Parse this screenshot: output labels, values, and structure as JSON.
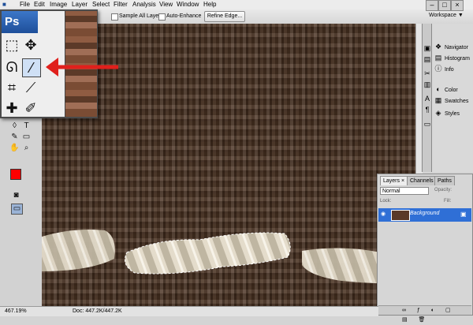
{
  "menu": {
    "items": [
      {
        "id": "file",
        "label": "File"
      },
      {
        "id": "edit",
        "label": "Edit"
      },
      {
        "id": "image",
        "label": "Image"
      },
      {
        "id": "layer",
        "label": "Layer"
      },
      {
        "id": "select",
        "label": "Select"
      },
      {
        "id": "filter",
        "label": "Filter"
      },
      {
        "id": "analysis",
        "label": "Analysis"
      },
      {
        "id": "view",
        "label": "View"
      },
      {
        "id": "window",
        "label": "Window"
      },
      {
        "id": "help",
        "label": "Help"
      }
    ]
  },
  "options": {
    "sample_all_layers": "Sample All Layers",
    "auto_enhance": "Auto-Enhance",
    "refine_edge": "Refine Edge...",
    "workspace": "Workspace ▼"
  },
  "tools": {
    "logo": "Ps"
  },
  "dock": {
    "items": [
      {
        "id": "navigator",
        "label": "Navigator",
        "icon": "❖"
      },
      {
        "id": "histogram",
        "label": "Histogram",
        "icon": "▤"
      },
      {
        "id": "info",
        "label": "Info",
        "icon": "ⓘ"
      },
      {
        "id": "color",
        "label": "Color",
        "icon": "◐"
      },
      {
        "id": "swatches",
        "label": "Swatches",
        "icon": "▦"
      },
      {
        "id": "styles",
        "label": "Styles",
        "icon": "◈"
      }
    ]
  },
  "layers_panel": {
    "tabs": [
      {
        "id": "layers",
        "label": "Layers ×"
      },
      {
        "id": "channels",
        "label": "Channels"
      },
      {
        "id": "paths",
        "label": "Paths"
      }
    ],
    "blend_mode": "Normal",
    "opacity_label": "Opacity:",
    "lock_label": "Lock:",
    "fill_label": "Fill:",
    "layer_name": "Background"
  },
  "status": {
    "zoom": "467.19%",
    "doc": "Doc: 447.2K/447.2K"
  },
  "colors": {
    "foreground": "#ff0000",
    "background": "#000000",
    "arrow": "#e0201c",
    "selection_accent": "#2f6fd6"
  }
}
